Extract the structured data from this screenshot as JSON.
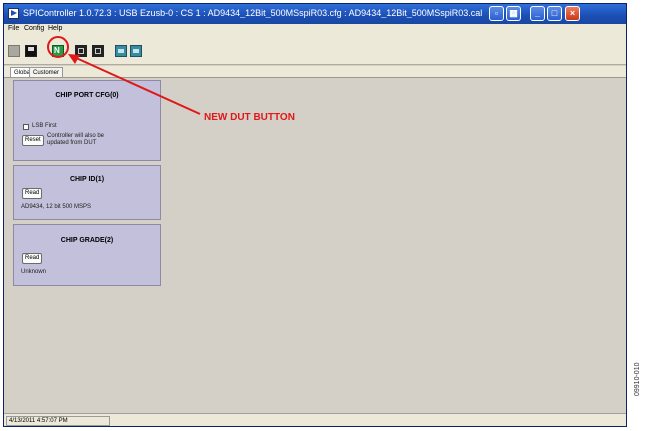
{
  "window": {
    "title": "SPIController 1.0.72.3 : USB Ezusb-0 : CS 1 : AD9434_12Bit_500MSspiR03.cfg : AD9434_12Bit_500MSspiR03.cal"
  },
  "menu": [
    "File",
    "Config",
    "Help"
  ],
  "tabs": [
    "Global",
    "Customer"
  ],
  "chip_port_cfg": {
    "title": "CHIP PORT CFG(0)",
    "checkbox_label": "LSB First",
    "reset_label": "Reset",
    "note_line1": "Controller will also be",
    "note_line2": "updated from DUT"
  },
  "chip_id": {
    "title": "CHIP ID(1)",
    "read_label": "Read",
    "value": "AD9434, 12 bit 500 MSPS"
  },
  "chip_grade": {
    "title": "CHIP GRADE(2)",
    "read_label": "Read",
    "value": "Unknown"
  },
  "status": {
    "timestamp": "4/13/2011 4:57:07 PM"
  },
  "annotation": {
    "callout": "NEW DUT BUTTON",
    "figure_id": "09910-010"
  },
  "colors": {
    "annotation": "#e01818",
    "panel": "#c2c0da",
    "titlebar": "#1b4fb5"
  }
}
